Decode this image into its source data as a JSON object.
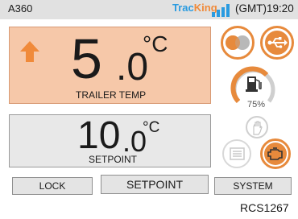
{
  "header": {
    "device_name": "A360",
    "logo_part1": "Trac",
    "logo_part2": "King",
    "clock": "(GMT)19:20"
  },
  "trailer_temp": {
    "integer": "5",
    "decimal": ".0",
    "unit": "°C",
    "label": "TRAILER TEMP",
    "trend": "up-arrow-icon"
  },
  "setpoint": {
    "integer": "10",
    "decimal": ".0",
    "unit": "°C",
    "label": "SETPOINT"
  },
  "buttons": {
    "lock": "LOCK",
    "setpoint": "SETPOINT",
    "system": "SYSTEM"
  },
  "fuel": {
    "percent_label": "75%",
    "level": 0.75
  },
  "footer": {
    "unit_id": "RCS1267"
  },
  "icons": [
    "status-icon",
    "usb-icon",
    "fuel-pump-icon",
    "hand-icon",
    "list-icon",
    "engine-icon"
  ],
  "colors": {
    "accent": "#e78a3c",
    "temp_panel": "#f6c8a9",
    "setpoint_panel": "#e8e8e8",
    "titlebar": "#e1e1e1",
    "logo_blue": "#2a9be0"
  }
}
